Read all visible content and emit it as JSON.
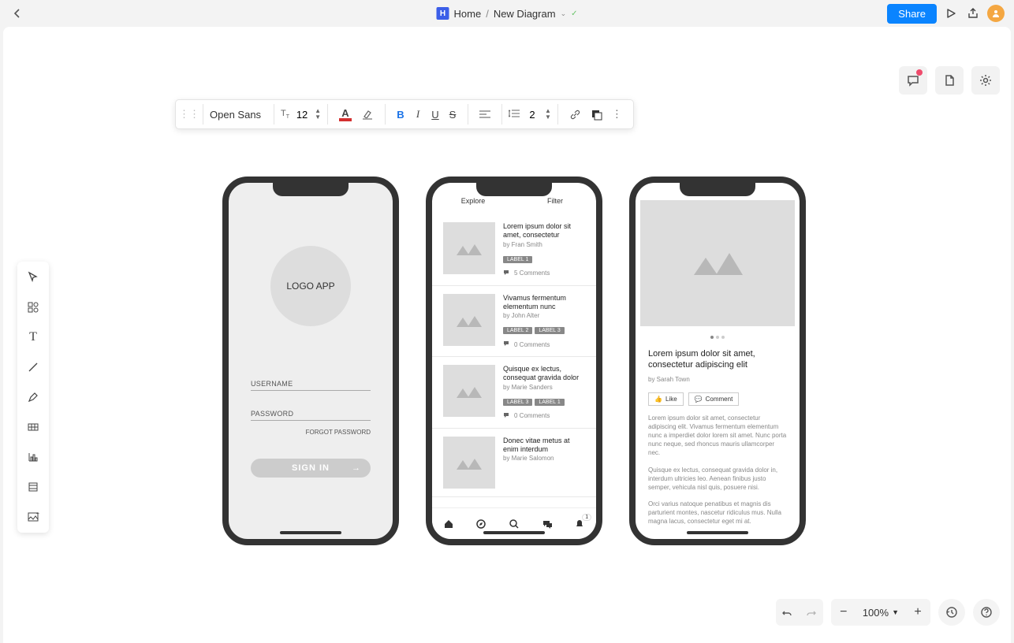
{
  "header": {
    "logo_letter": "H",
    "home_label": "Home",
    "doc_name": "New Diagram",
    "share_label": "Share"
  },
  "fmt": {
    "font_name": "Open Sans",
    "font_size": "12",
    "line_height": "2"
  },
  "zoom": {
    "value": "100%"
  },
  "screen1": {
    "logo_text": "LOGO APP",
    "username_label": "USERNAME",
    "password_label": "PASSWORD",
    "forgot_label": "FORGOT PASSWORD",
    "signin_label": "SIGN IN"
  },
  "screen2": {
    "tab1": "Explore",
    "tab2": "Filter",
    "items": [
      {
        "title": "Lorem ipsum dolor sit amet, consectetur",
        "by": "by Fran Smith",
        "labels": [
          "LABEL 1"
        ],
        "comments": "5 Comments"
      },
      {
        "title": "Vivamus fermentum elementum nunc",
        "by": "by John Alter",
        "labels": [
          "LABEL 2",
          "LABEL 3"
        ],
        "comments": "0 Comments"
      },
      {
        "title": "Quisque ex lectus, consequat gravida dolor",
        "by": "by Marie Sanders",
        "labels": [
          "LABEL 3",
          "LABEL 1"
        ],
        "comments": "0 Comments"
      },
      {
        "title": "Donec vitae metus at enim interdum",
        "by": "by Marie Salomon",
        "labels": [],
        "comments": ""
      }
    ],
    "nav_badge": "1"
  },
  "screen3": {
    "title": "Lorem ipsum dolor sit amet, consectetur adipiscing elit",
    "by": "by Sarah Town",
    "like_label": "Like",
    "comment_label": "Comment",
    "p1": "Lorem ipsum dolor sit amet, consectetur adipiscing elit. Vivamus fermentum elementum nunc a imperdiet dolor lorem sit amet. Nunc porta nunc neque, sed rhoncus mauris ullamcorper nec.",
    "p2": "Quisque ex lectus, consequat gravida dolor in, interdum ultricies leo. Aenean finibus justo semper, vehicula nisl quis, posuere nisi.",
    "p3": "Orci varius natoque penatibus et magnis dis parturient montes, nascetur ridiculus mus. Nulla magna lacus, consectetur eget mi at."
  }
}
